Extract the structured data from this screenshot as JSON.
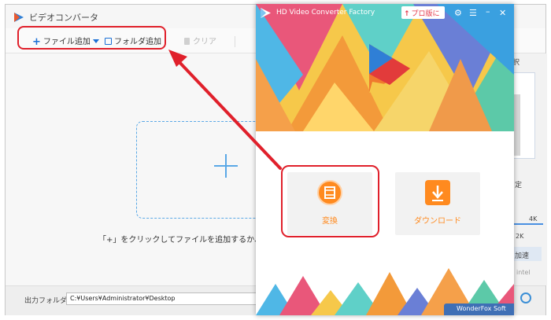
{
  "background_window": {
    "title": "ビデオコンバータ",
    "toolbar": {
      "add_file_label": "ファイル追加",
      "add_folder_label": "フォルダ追加",
      "clear_label": "クリア"
    },
    "drop_hint": "「+」をクリックしてファイルを追加するか、またはファ",
    "footer": {
      "output_folder_label": "出力フォルダ：",
      "output_path": "C:¥Users¥Administrator¥Desktop"
    },
    "right_panel_fragments": {
      "select": "択",
      "settings": "定",
      "res_4k": "4K",
      "res_2k": "2K",
      "accelerate": "加速",
      "intel": "intel"
    }
  },
  "foreground_window": {
    "title": "HD Video Converter Factory",
    "pro_button_label": "プロ版に",
    "features": [
      {
        "label": "変換",
        "icon": "film-icon"
      },
      {
        "label": "ダウンロード",
        "icon": "download-icon"
      }
    ],
    "brand_badge": "WonderFox Soft"
  },
  "colors": {
    "accent_orange": "#ff8a1f",
    "highlight_red": "#e0202b",
    "toolbar_blue": "#1a6fd6",
    "dropzone_blue": "#5aa8e6"
  }
}
